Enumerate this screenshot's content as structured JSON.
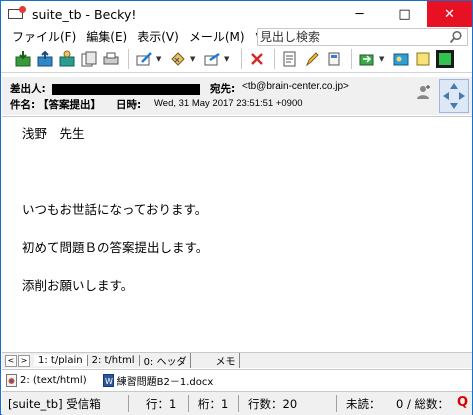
{
  "window": {
    "title": "suite_tb - Becky!",
    "controls": {
      "minimize": "─",
      "maximize": "□",
      "close": "✕"
    }
  },
  "menu": {
    "items": [
      "ファイル(F)",
      "編集(E)",
      "表示(V)",
      "メール(M)",
      "ツー"
    ],
    "search_placeholder": "見出し検索"
  },
  "header": {
    "from_label": "差出人:",
    "to_label": "宛先:",
    "to_value": "<tb@brain-center.co.jp>",
    "subject_label": "件名:",
    "subject_value": "【答案提出】",
    "date_label": "日時:",
    "date_value": "Wed, 31 May 2017 23:51:51 +0900"
  },
  "body": {
    "lines": [
      "浅野　先生",
      "いつもお世話になっております。",
      "初めて問題Ｂの答案提出します。",
      "添削お願いします。"
    ]
  },
  "tabs": {
    "nav_prev": "<",
    "nav_next": ">",
    "items": [
      "1: t/plain",
      "2: t/html",
      "0: ヘッダ",
      "メモ"
    ]
  },
  "attachments": {
    "items": [
      "2: (text/html)",
      "練習問題B2－1.docx"
    ]
  },
  "status": {
    "folder": "[suite_tb] 受信箱",
    "row": "行：1",
    "col": "桁：1",
    "lines": "行数：20",
    "unread": "未読：",
    "counts": "0 / 総数："
  },
  "colors": {
    "accent_blue": "#1a6fc9",
    "close_red": "#e81123",
    "header_bg": "#f0f0f0"
  }
}
